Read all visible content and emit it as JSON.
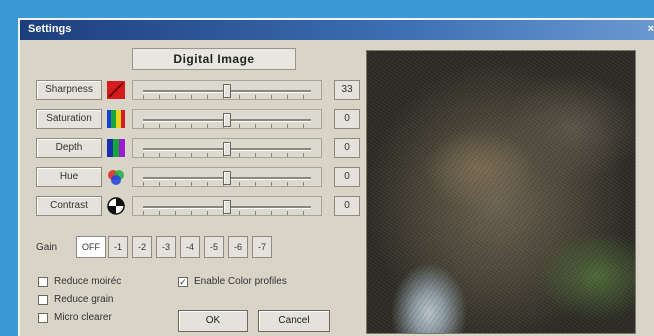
{
  "window": {
    "title": "Settings",
    "close_glyph": "×"
  },
  "header_label": "Digital Image",
  "adjustments": [
    {
      "label": "Sharpness",
      "icon": "sharpness-icon",
      "value": "33",
      "slider_fraction": 0.5
    },
    {
      "label": "Saturation",
      "icon": "saturation-icon",
      "value": "0",
      "slider_fraction": 0.5
    },
    {
      "label": "Depth",
      "icon": "depth-icon",
      "value": "0",
      "slider_fraction": 0.5
    },
    {
      "label": "Hue",
      "icon": "hue-icon",
      "value": "0",
      "slider_fraction": 0.5
    },
    {
      "label": "Contrast",
      "icon": "contrast-icon",
      "value": "0",
      "slider_fraction": 0.5
    }
  ],
  "gain": {
    "label": "Gain",
    "options": [
      "OFF",
      "-1",
      "-2",
      "-3",
      "-4",
      "-5",
      "-6",
      "-7"
    ],
    "selected": "OFF"
  },
  "checkboxes": {
    "reduce_moire": {
      "label": "Reduce moiréc",
      "checked": false
    },
    "reduce_grain": {
      "label": "Reduce grain",
      "checked": false
    },
    "micro_clearer": {
      "label": "Micro clearer",
      "checked": false
    },
    "enable_color_profiles": {
      "label": "Enable Color profiles",
      "checked": true
    }
  },
  "buttons": {
    "ok": "OK",
    "cancel": "Cancel"
  },
  "colors": {
    "titlebar": "#1d3e7c",
    "dialog": "#d8d4c8",
    "desktop": "#3a9ad4"
  }
}
